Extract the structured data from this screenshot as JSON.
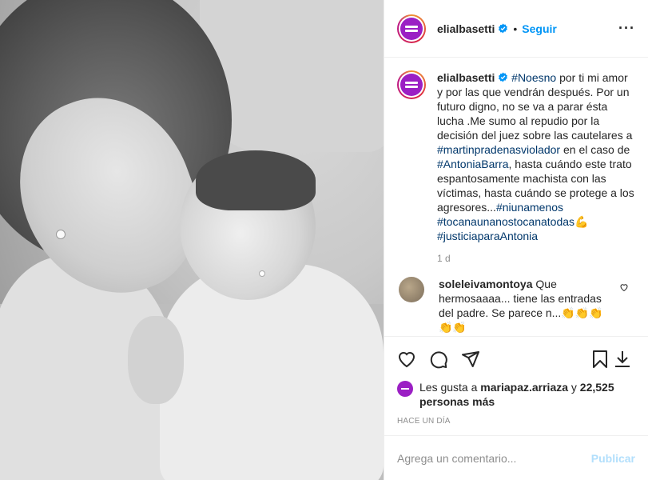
{
  "post": {
    "username": "elialbasetti",
    "follow_label": "Seguir",
    "dot": "•",
    "more": "···"
  },
  "caption": {
    "username": "elialbasetti",
    "parts": {
      "t1": "#Noesno",
      "p1": " por ti mi amor y por las que vendrán después. Por un futuro digno, no se va a parar ésta lucha .Me sumo al repudio por la decisión del juez sobre las cautelares a ",
      "t2": "#martinpradenasviolador",
      "p2": " en el caso de ",
      "t3": "#AntoniaBarra",
      "p3": ", hasta cuándo este trato espantosamente machista con las víctimas, hasta cuándo se protege a los agresores...",
      "t4": "#niunamenos",
      "t5": "#tocanaunanostocanatodas",
      "emoji": "💪",
      "t6": "#justiciaparaAntonia"
    },
    "time": "1 d"
  },
  "comment": {
    "username": "soleleivamontoya",
    "text": " Que hermosaaaa... tiene las entradas del padre. Se parece n...",
    "emojis": "👏👏👏👏👏"
  },
  "likes": {
    "prefix": "Les gusta a ",
    "user": "mariapaz.arriaza",
    "mid": " y ",
    "count": "22,525 personas más"
  },
  "time_ago": "HACE UN DÍA",
  "add_comment": {
    "placeholder": "Agrega un comentario...",
    "publish": "Publicar"
  },
  "icons": [
    "verified-icon",
    "more-options-icon",
    "heart-icon",
    "comment-icon",
    "share-icon",
    "bookmark-icon",
    "save-download-icon",
    "small-heart-icon"
  ],
  "colors": {
    "link": "#0095f6",
    "hashtag": "#00376b",
    "avatar_bg": "#9b1fc4",
    "publish_disabled": "#b2dffc"
  }
}
